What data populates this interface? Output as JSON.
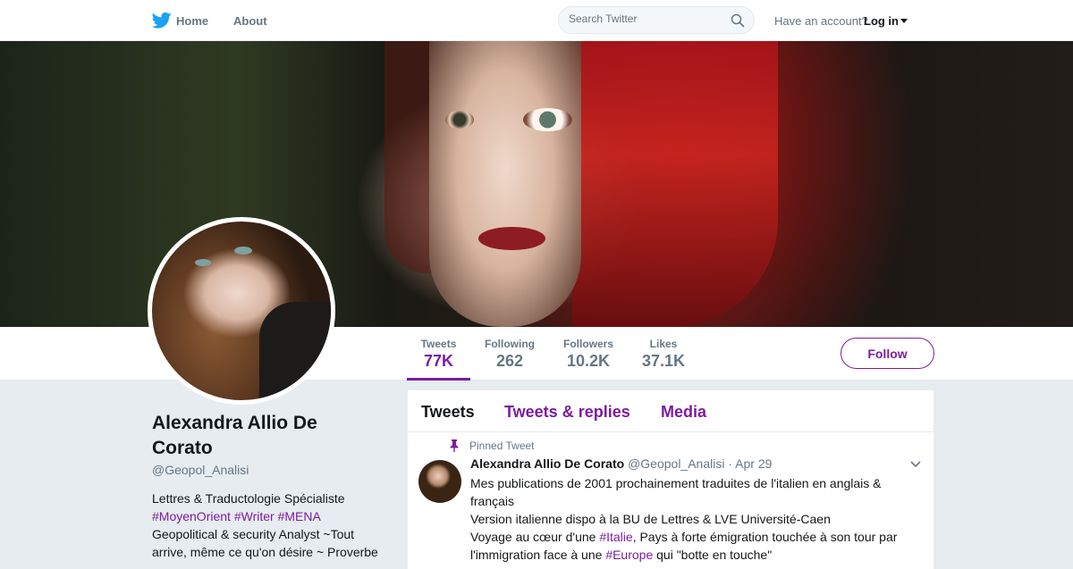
{
  "nav": {
    "home_label": "Home",
    "about_label": "About",
    "search_placeholder": "Search Twitter",
    "account_prompt": "Have an account?",
    "login_label": "Log in"
  },
  "colors": {
    "accent": "#7d1c9e",
    "brand_blue": "#1da1f2",
    "background": "#e6ecf0"
  },
  "icons": [
    "twitter-bird-icon",
    "search-icon",
    "caret-down-icon",
    "pin-icon",
    "chevron-down-icon"
  ],
  "profile": {
    "name_line1": "Alexandra Allio De",
    "name_line2": "Corato",
    "handle": "@Geopol_Analisi",
    "bio_line1": "Lettres & Traductologie Spécialiste",
    "bio_tags": [
      "#MoyenOrient",
      "#Writer",
      "#MENA"
    ],
    "bio_line3": "Geopolitical & security Analyst ~Tout",
    "bio_line4": "arrive, même ce qu'on désire ~ Proverbe"
  },
  "stats": [
    {
      "label": "Tweets",
      "value": "77K"
    },
    {
      "label": "Following",
      "value": "262"
    },
    {
      "label": "Followers",
      "value": "10.2K"
    },
    {
      "label": "Likes",
      "value": "37.1K"
    }
  ],
  "follow_label": "Follow",
  "timeline": {
    "tabs": [
      "Tweets",
      "Tweets & replies",
      "Media"
    ],
    "pinned_label": "Pinned Tweet",
    "tweet": {
      "author": "Alexandra Allio De Corato",
      "handle": "@Geopol_Analisi",
      "date": "· Apr 29",
      "line1": "Mes publications de 2001 prochainement traduites de l'italien en anglais &",
      "line2": "français",
      "line3": "Version italienne dispo à la BU de Lettres & LVE Université-Caen",
      "line4_a": "Voyage au cœur d'une ",
      "line4_tag": "#Italie",
      "line4_b": ", Pays à forte émigration touchée à son tour par",
      "line5_a": "l'immigration face à une ",
      "line5_tag": "#Europe",
      "line5_b": " qui \"botte en touche\""
    }
  }
}
